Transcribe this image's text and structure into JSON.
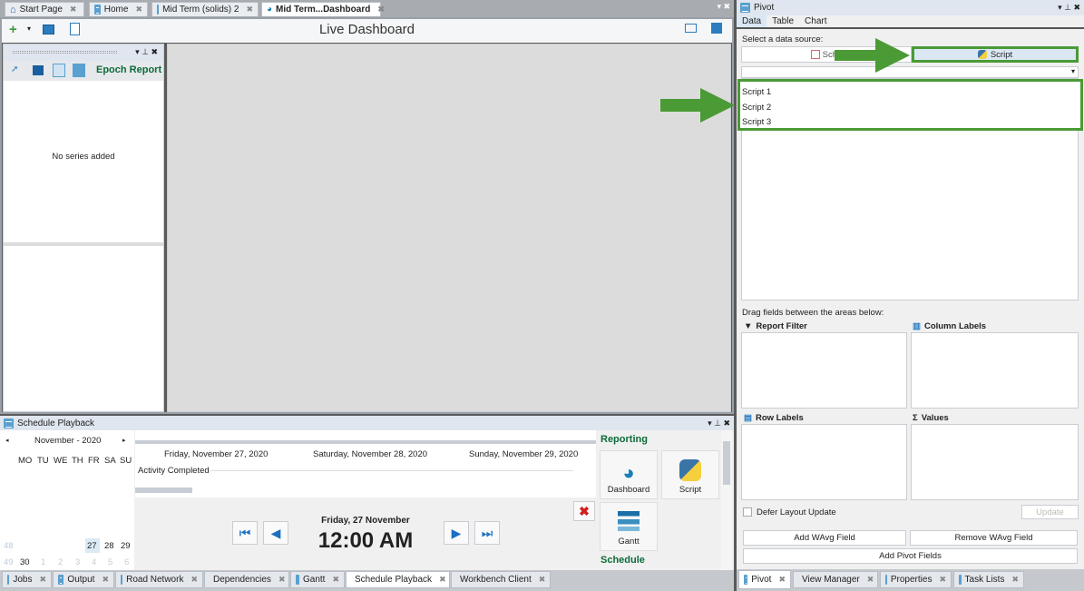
{
  "doc_tabs": [
    {
      "label": "Start Page",
      "icon": "home-icon"
    },
    {
      "label": "Home",
      "icon": "document-icon"
    },
    {
      "label": "Mid Term (solids) 2",
      "icon": "schedule-icon"
    },
    {
      "label": "Mid Term...Dashboard",
      "icon": "dashboard-icon"
    }
  ],
  "dashboard": {
    "title": "Live Dashboard",
    "epoch_report": "Epoch Report",
    "no_series": "No series added"
  },
  "schedule_playback": {
    "title": "Schedule Playback",
    "month": "November - 2020",
    "weekdays": [
      "MO",
      "TU",
      "WE",
      "TH",
      "FR",
      "SA",
      "SU"
    ],
    "week_numbers": [
      "48",
      "49"
    ],
    "row1": [
      "27",
      "28",
      "29"
    ],
    "row2": [
      "30",
      "1",
      "2",
      "3",
      "4",
      "5",
      "6"
    ],
    "selected_day": "27",
    "timeline_dates": [
      "Friday, November 27, 2020",
      "Saturday, November 28, 2020",
      "Sunday, November 29, 2020"
    ],
    "activity": "Activity Completed",
    "current_date": "Friday, 27 November",
    "current_time": "12:00 AM",
    "reporting_header": "Reporting",
    "tiles": [
      "Dashboard",
      "Script",
      "Gantt"
    ],
    "schedule_header": "Schedule"
  },
  "bottom_tabs": [
    "Jobs",
    "Output",
    "Road Network",
    "Dependencies",
    "Gantt",
    "Schedule Playback",
    "Workbench Client"
  ],
  "pivot": {
    "title": "Pivot",
    "tabs": [
      "Data",
      "Table",
      "Chart"
    ],
    "select_label": "Select a data source:",
    "source_schedule": "Sche",
    "source_script": "Script",
    "scripts": [
      "Script 1",
      "Script 2",
      "Script 3"
    ],
    "drag_label": "Drag fields between the areas below:",
    "areas": [
      "Report Filter",
      "Column Labels",
      "Row Labels",
      "Values"
    ],
    "defer": "Defer Layout Update",
    "update": "Update",
    "add_wavg": "Add WAvg Field",
    "remove_wavg": "Remove WAvg Field",
    "add_pivot": "Add Pivot Fields",
    "bottom_tabs": [
      "Pivot",
      "View Manager",
      "Properties",
      "Task Lists"
    ]
  },
  "colors": {
    "accent_green": "#4a9a35",
    "header_green": "#0d6b3a"
  }
}
